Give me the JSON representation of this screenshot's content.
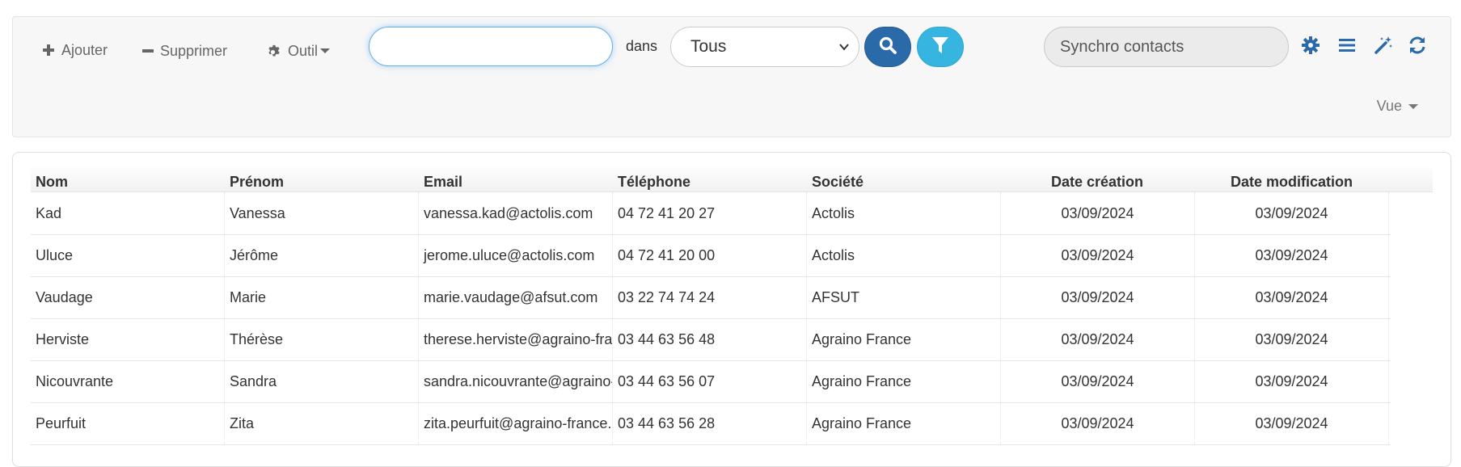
{
  "toolbar": {
    "add_label": "Ajouter",
    "delete_label": "Supprimer",
    "tools_label": "Outil",
    "search": {
      "value": "",
      "placeholder": ""
    },
    "in_label": "dans",
    "scope_select": {
      "selected": "Tous"
    },
    "sync_label": "Synchro contacts",
    "view_label": "Vue",
    "icons": [
      "plus-icon",
      "minus-icon",
      "gear-icon",
      "search-icon",
      "filter-icon",
      "gear-icon",
      "list-icon",
      "magic-wand-icon",
      "refresh-icon"
    ]
  },
  "colors": {
    "primary": "#2a6aa8",
    "info": "#35b5df",
    "icon_blue": "#2a6aa8",
    "focus": "#66afe9"
  },
  "table": {
    "columns": [
      "Nom",
      "Prénom",
      "Email",
      "Téléphone",
      "Société",
      "Date création",
      "Date modification"
    ],
    "rows": [
      [
        "Kad",
        "Vanessa",
        "vanessa.kad@actolis.com",
        "04 72 41 20 27",
        "Actolis",
        "03/09/2024",
        "03/09/2024"
      ],
      [
        "Uluce",
        "Jérôme",
        "jerome.uluce@actolis.com",
        "04 72 41 20 00",
        "Actolis",
        "03/09/2024",
        "03/09/2024"
      ],
      [
        "Vaudage",
        "Marie",
        "marie.vaudage@afsut.com",
        "03 22 74 74 24",
        "AFSUT",
        "03/09/2024",
        "03/09/2024"
      ],
      [
        "Herviste",
        "Thérèse",
        "therese.herviste@agraino-fra",
        "03 44 63 56 48",
        "Agraino France",
        "03/09/2024",
        "03/09/2024"
      ],
      [
        "Nicouvrante",
        "Sandra",
        "sandra.nicouvrante@agraino-",
        "03 44 63 56 07",
        "Agraino France",
        "03/09/2024",
        "03/09/2024"
      ],
      [
        "Peurfuit",
        "Zita",
        "zita.peurfuit@agraino-france.",
        "03 44 63 56 28",
        "Agraino France",
        "03/09/2024",
        "03/09/2024"
      ]
    ]
  }
}
